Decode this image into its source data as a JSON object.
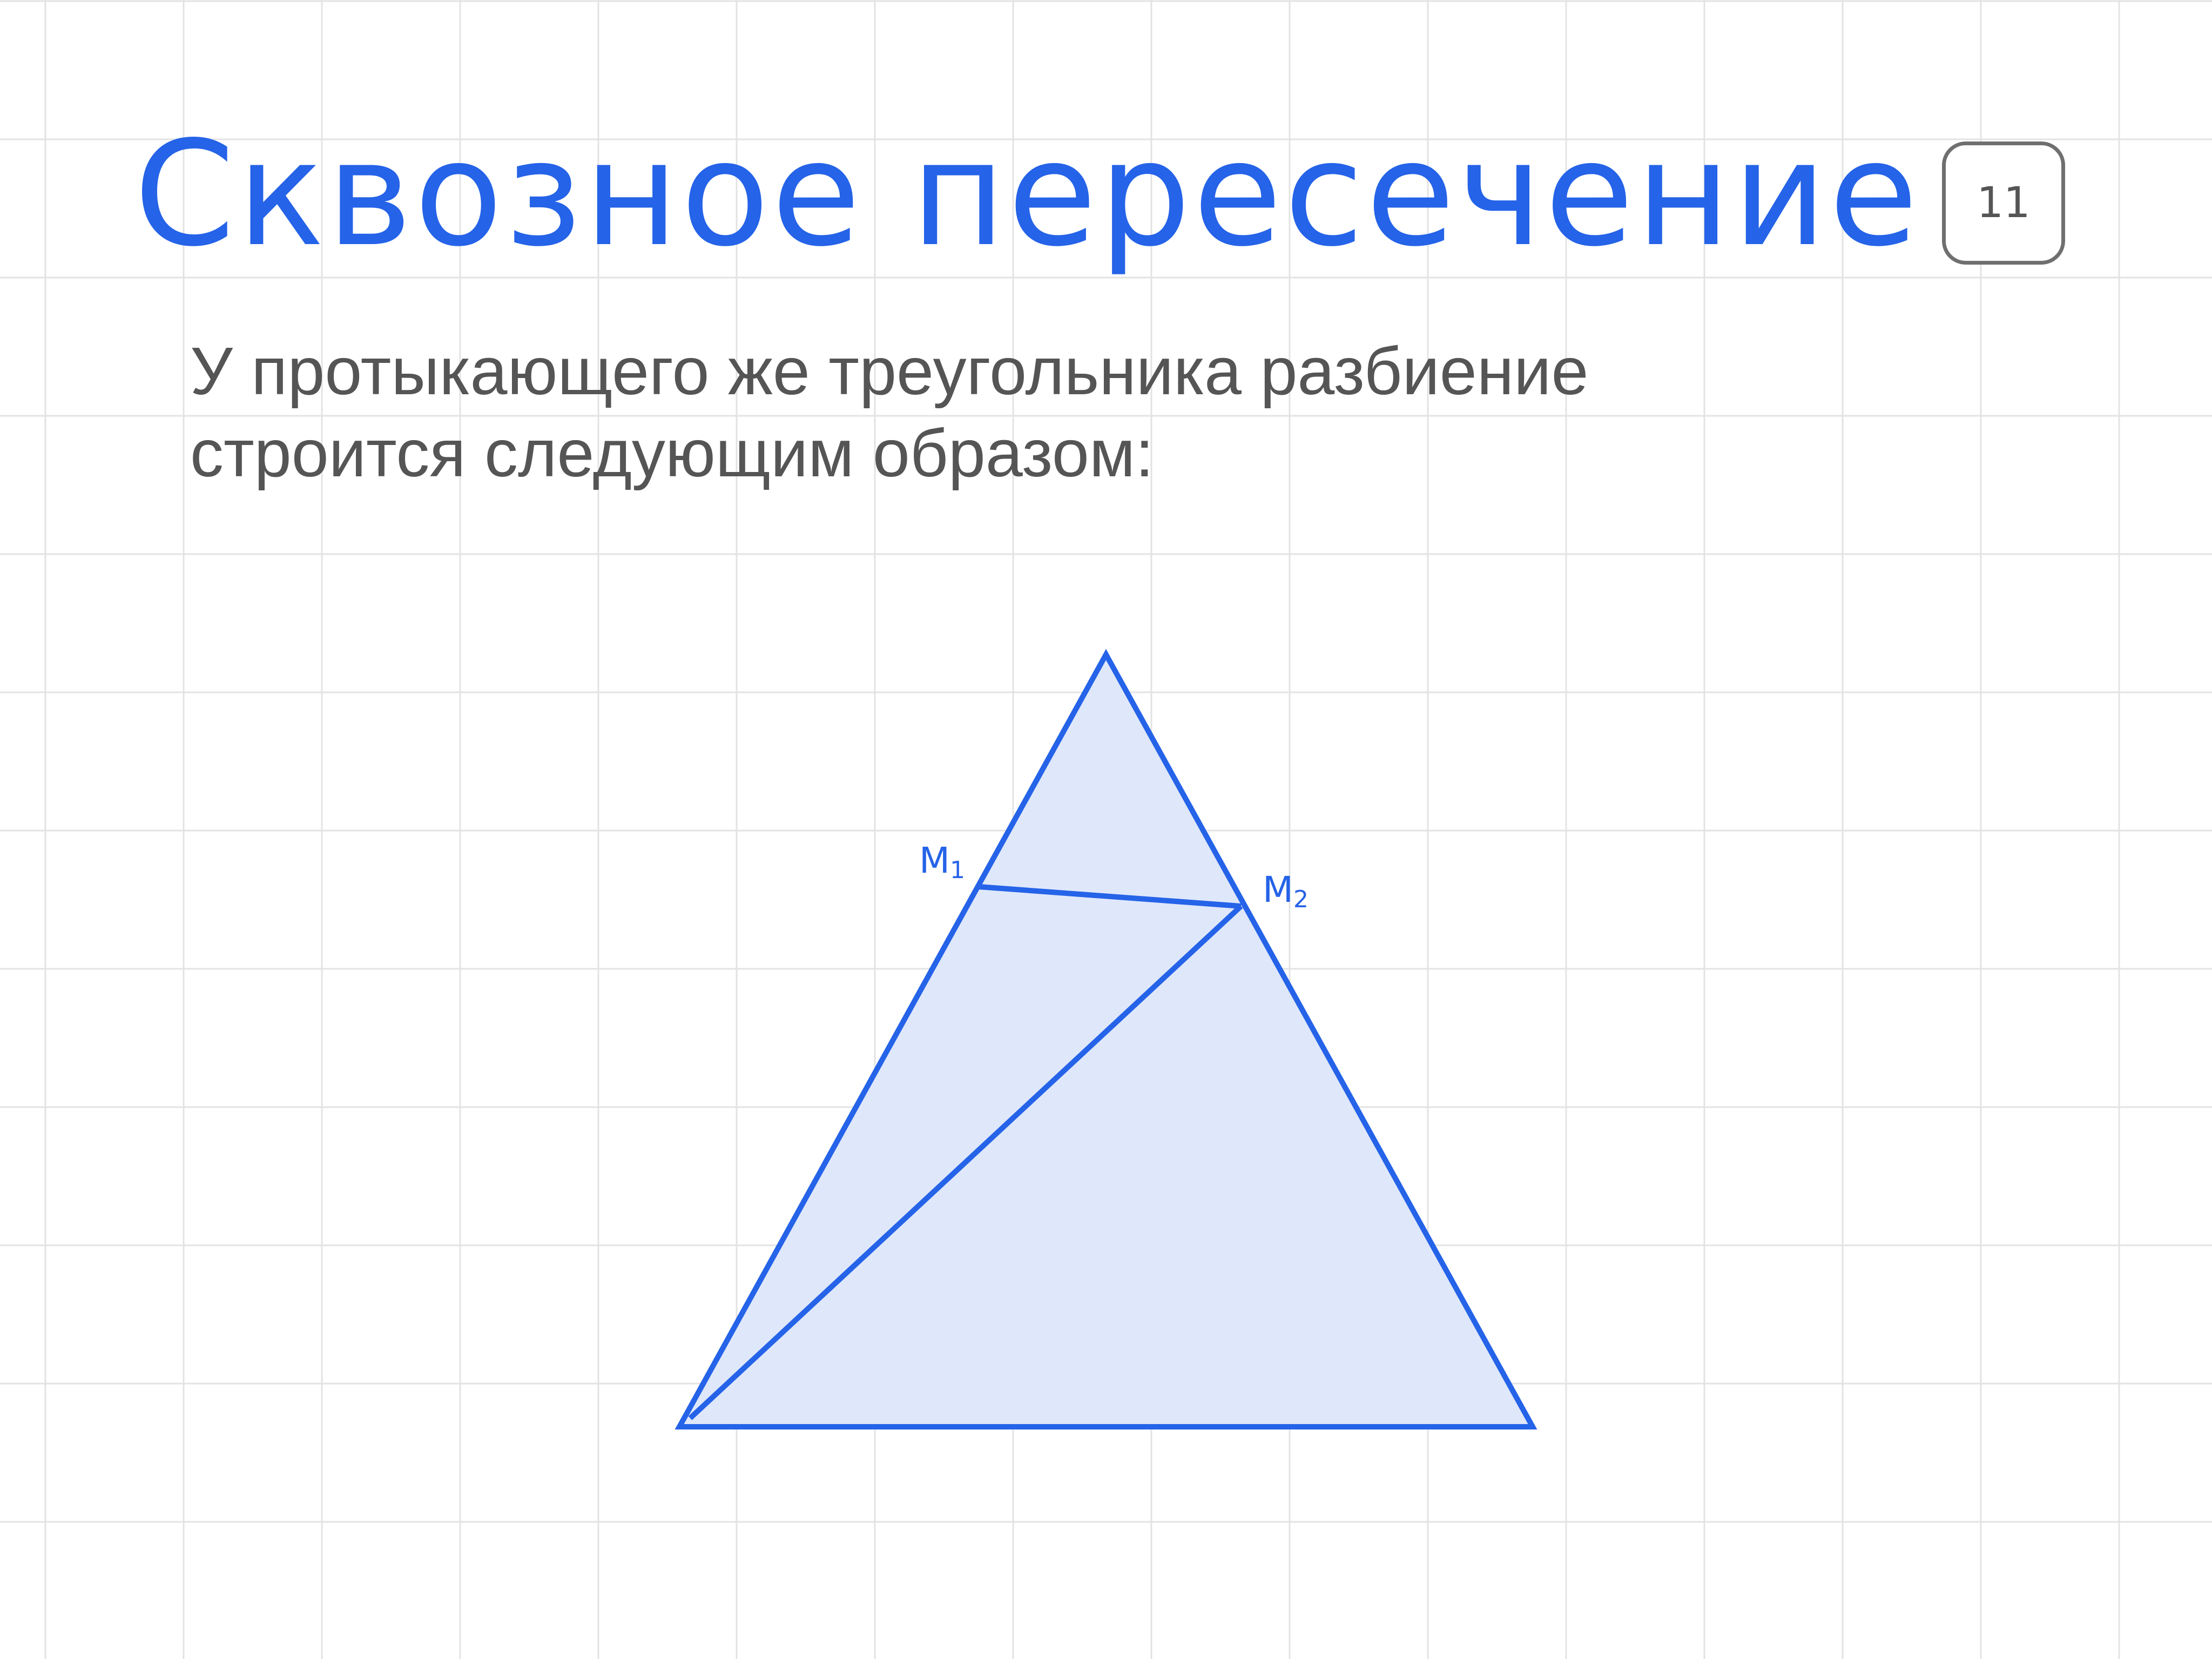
{
  "slide": {
    "title": "Сквозное пересечение",
    "page_number": "11",
    "body_lines": [
      "У протыкающего же треугольника разбиение",
      "строится следующим образом:"
    ]
  },
  "diagram": {
    "points": [
      {
        "name": "M1",
        "letter": "M",
        "index": "1"
      },
      {
        "name": "M2",
        "letter": "M",
        "index": "2"
      }
    ]
  },
  "colors": {
    "accent": "#2563e8",
    "triangle_fill": "#dfe7fb",
    "body_text": "#555555",
    "grid_line": "#e3e3e3",
    "badge_border": "#6f6f6f"
  }
}
